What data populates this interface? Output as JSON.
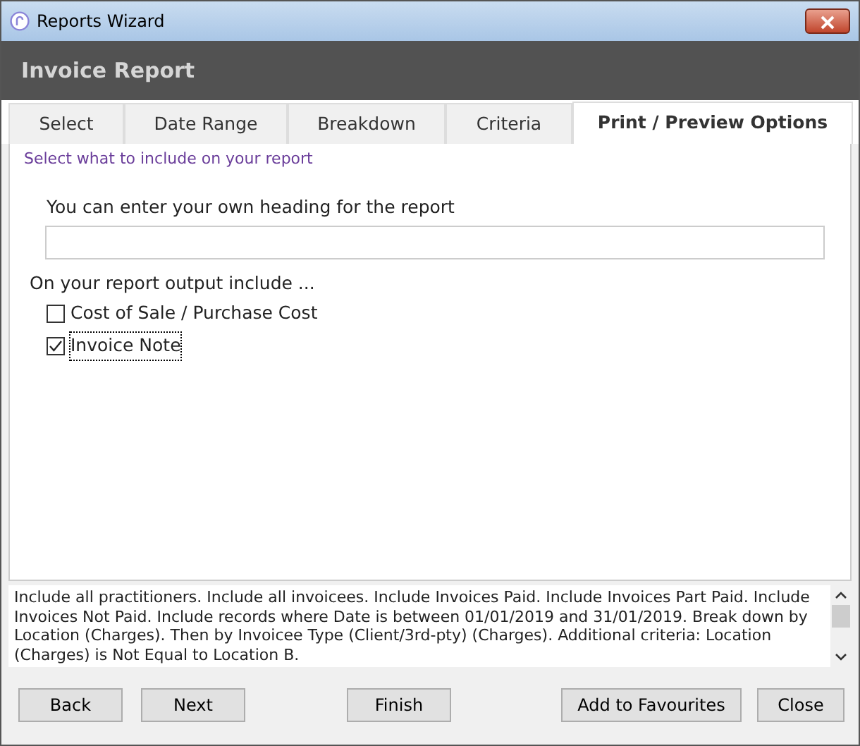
{
  "window": {
    "title": "Reports Wizard"
  },
  "header": {
    "title": "Invoice Report"
  },
  "tabs": [
    {
      "label": "Select",
      "selected": false
    },
    {
      "label": "Date Range",
      "selected": false
    },
    {
      "label": "Breakdown",
      "selected": false
    },
    {
      "label": "Criteria",
      "selected": false
    },
    {
      "label": "Print / Preview Options",
      "selected": true
    }
  ],
  "instruction": "Select what to include on your report",
  "heading_field": {
    "label": "You can enter your own heading for the report"
  },
  "include_label": "On your report output include ...",
  "options": [
    {
      "label": "Cost of Sale / Purchase Cost",
      "checked": false,
      "focused": false
    },
    {
      "label": "Invoice Note",
      "checked": true,
      "focused": true
    }
  ],
  "summary": "Include all practitioners. Include all invoicees. Include Invoices Paid. Include Invoices Part Paid. Include Invoices Not Paid. Include records where Date is between 01/01/2019 and 31/01/2019. Break down by Location (Charges). Then by Invoicee Type (Client/3rd-pty) (Charges). Additional criteria: Location (Charges) is Not Equal to Location B.",
  "buttons": [
    {
      "label": "Back",
      "kind": "left"
    },
    {
      "label": "Next",
      "kind": "left"
    },
    {
      "label": "Finish",
      "kind": "center"
    },
    {
      "label": "Add to Favourites",
      "kind": "right"
    },
    {
      "label": "Close",
      "kind": "right"
    }
  ]
}
